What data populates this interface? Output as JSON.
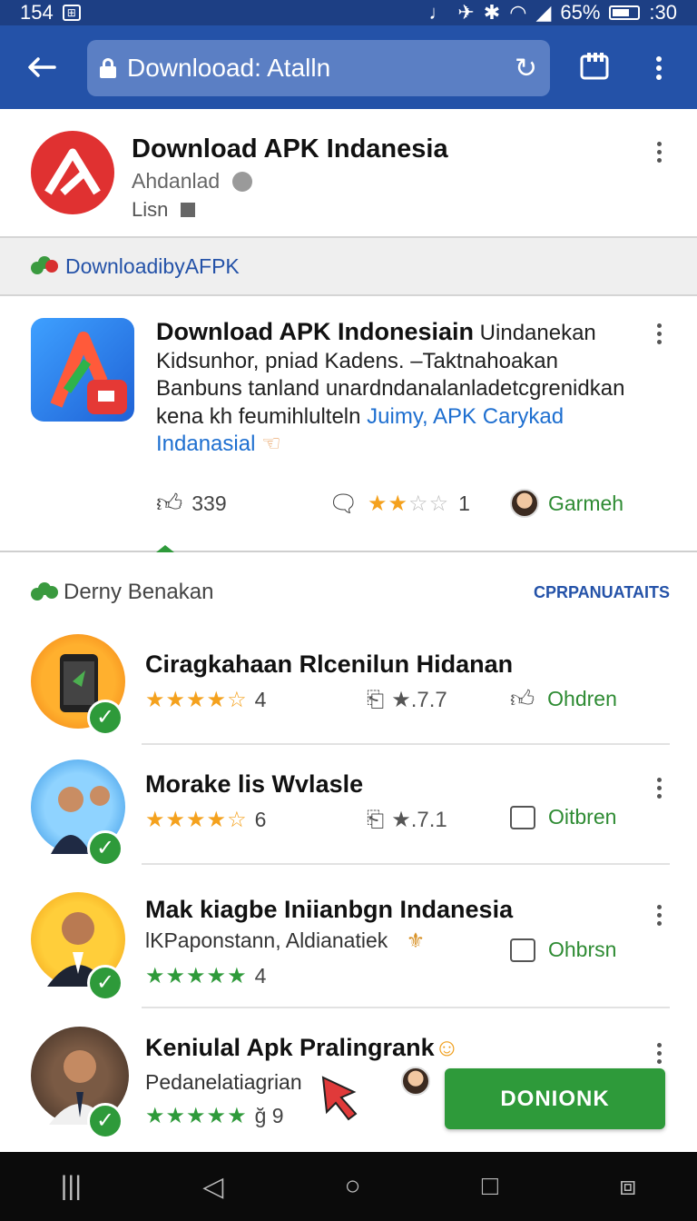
{
  "status_bar": {
    "time_left": "154",
    "battery": "65%",
    "clock": ":30"
  },
  "toolbar": {
    "url": "Downlooad: Atalln"
  },
  "app": {
    "title": "Download APK Indanesia",
    "subtitle": "Ahdanlad",
    "subtitle2": "Lisn"
  },
  "section": {
    "label": "DownloadibyAFPK"
  },
  "feature": {
    "title": "Download APK Indonesiain",
    "title_tail": " Uindanekan",
    "line2": "Kidsunhor, pniad Kadens. –Taktnahoаkan",
    "line3": "Banbuns tanland unardndanalanladetcgrenidkan",
    "line4": "kena kh feumihlulteln",
    "link": "Juimy, APK Carykad Indanasial",
    "likes": "339",
    "rating_count": "1",
    "author": "Garmeh"
  },
  "related": {
    "title": "Derny Benakan",
    "action": "CPRPANUATAITS",
    "items": [
      {
        "title": "Ciragkahaan Rlcenilun Hidanan",
        "rating": "4",
        "meta": "★.7.7",
        "action": "Ohdren"
      },
      {
        "title": "Morake lis Wvlasle",
        "rating": "6",
        "meta": "★.7.1",
        "action": "Oitbren"
      },
      {
        "title": "Mak kiagbe Iniianbgn Indanesia",
        "subtitle": "lKPaponstann, Aldianatiek",
        "rating": "4",
        "action": "Ohbrsn"
      },
      {
        "title": "Keniulal Apk Pralingrank",
        "subtitle": "Pedanelatiagrian",
        "rating": "ğ 9"
      }
    ]
  },
  "download_button": "DONIONK"
}
